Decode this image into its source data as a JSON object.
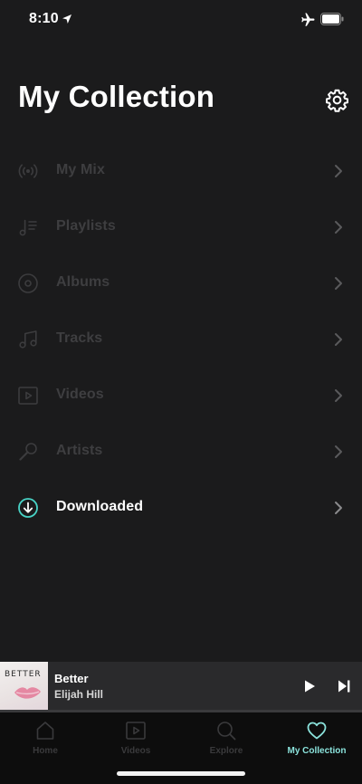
{
  "status_bar": {
    "time": "8:10"
  },
  "header": {
    "title": "My Collection"
  },
  "menu": {
    "items": [
      {
        "label": "My Mix",
        "icon": "radio-icon",
        "enabled": false
      },
      {
        "label": "Playlists",
        "icon": "playlist-icon",
        "enabled": false
      },
      {
        "label": "Albums",
        "icon": "album-icon",
        "enabled": false
      },
      {
        "label": "Tracks",
        "icon": "music-note-icon",
        "enabled": false
      },
      {
        "label": "Videos",
        "icon": "video-icon",
        "enabled": false
      },
      {
        "label": "Artists",
        "icon": "microphone-icon",
        "enabled": false
      },
      {
        "label": "Downloaded",
        "icon": "download-icon",
        "enabled": true
      }
    ]
  },
  "player": {
    "album_art_text": "BETTER",
    "title": "Better",
    "artist": "Elijah Hill",
    "progress": 0.0
  },
  "tab_bar": {
    "tabs": [
      {
        "label": "Home",
        "icon": "home-icon",
        "selected": false
      },
      {
        "label": "Videos",
        "icon": "video-icon",
        "selected": false
      },
      {
        "label": "Explore",
        "icon": "search-icon",
        "selected": false
      },
      {
        "label": "My Collection",
        "icon": "heart-icon",
        "selected": true
      }
    ]
  },
  "colors": {
    "accent": "#48d3c6",
    "tab_accent": "#8be3dc",
    "background": "#1b1b1c",
    "tab_bar": "#0d0d0d"
  }
}
